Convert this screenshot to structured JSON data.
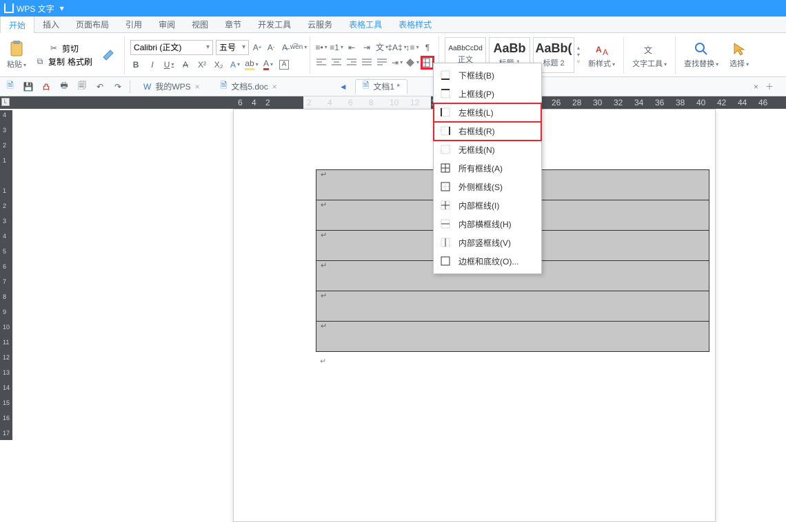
{
  "title": "WPS 文字",
  "tabs": {
    "start": "开始",
    "insert": "插入",
    "layout": "页面布局",
    "cite": "引用",
    "review": "审阅",
    "view": "视图",
    "chapter": "章节",
    "dev": "开发工具",
    "cloud": "云服务",
    "tbltool": "表格工具",
    "tblstyle": "表格样式"
  },
  "ribbon": {
    "cut": "剪切",
    "copy": "复制",
    "format_painter": "格式刷",
    "paste": "粘贴",
    "font_name": "Calibri (正文)",
    "font_size": "五号",
    "style_body_pv": "AaBbCcDd",
    "style_body": "正文",
    "style_h1_pv": "AaBb",
    "style_h1": "标题 1",
    "style_h2_pv": "AaBb(",
    "style_h2": "标题 2",
    "new_style": "新样式",
    "text_tool": "文字工具",
    "find_replace": "查找替换",
    "select": "选择"
  },
  "qar": {
    "mywps": "我的WPS",
    "doc5": "文档5.doc",
    "doc1": "文档1 *"
  },
  "ruler_nums": [
    "6",
    "4",
    "2",
    "",
    "2",
    "4",
    "6",
    "8",
    "10",
    "12",
    "14",
    "26",
    "28",
    "30",
    "32",
    "34",
    "36",
    "38",
    "40",
    "42",
    "44",
    "46"
  ],
  "vruler_nums": [
    "4",
    "3",
    "2",
    "1",
    "",
    "1",
    "2",
    "3",
    "4",
    "5",
    "6",
    "7",
    "8",
    "9",
    "10",
    "11",
    "12",
    "13",
    "14",
    "15",
    "16",
    "17"
  ],
  "menu": {
    "bottom": "下框线(B)",
    "top": "上框线(P)",
    "left": "左框线(L)",
    "right": "右框线(R)",
    "none": "无框线(N)",
    "all": "所有框线(A)",
    "outer": "外侧框线(S)",
    "inner": "内部框线(I)",
    "innerh": "内部横框线(H)",
    "innerv": "内部竖框线(V)",
    "shading": "边框和底纹(O)..."
  }
}
